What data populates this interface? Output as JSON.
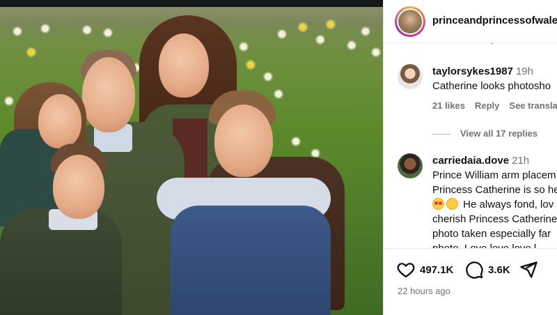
{
  "post": {
    "username": "princeandprincessofwale",
    "photo_alt": "Family photo in a daffodil meadow"
  },
  "comments": [
    {
      "username": "taylorsykes1987",
      "time": "19h",
      "text": "Catherine looks photosho",
      "likes": "21 likes",
      "reply": "Reply",
      "translate": "See translat"
    },
    {
      "username": "carriedaia.dove",
      "time": "21h",
      "lines": [
        "Prince William arm placem",
        "Princess Catherine is so he",
        "He always fond, lov",
        "cherish Princess Catherine",
        "photo taken especially far",
        "photo. Love love love l"
      ]
    }
  ],
  "view_replies": "View all 17 replies",
  "actions": {
    "likes_count": "497.1K",
    "comments_count": "3.6K",
    "timestamp": "22 hours ago"
  },
  "icons": {
    "like": "heart-outline-icon",
    "comment": "comment-bubble-icon",
    "share": "paper-plane-icon"
  }
}
